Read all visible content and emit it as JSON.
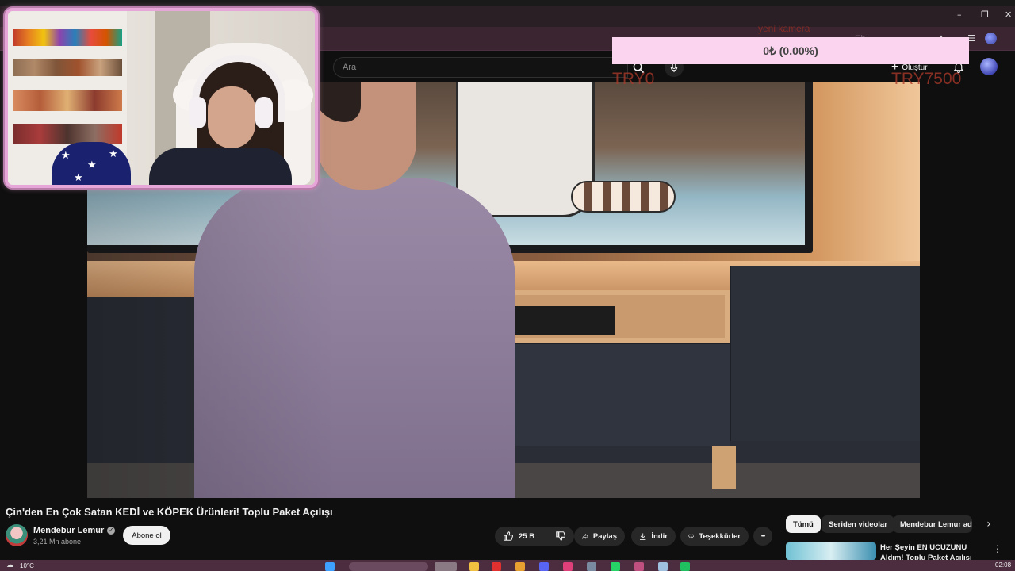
{
  "browser": {
    "window_controls": {
      "minimize": "–",
      "maximize": "❐",
      "close": "✕"
    },
    "ghost_toolbar_text": "Eh..."
  },
  "youtube": {
    "search": {
      "placeholder": "Ara"
    },
    "create_label": "Oluştur"
  },
  "donation_goal": {
    "title": "yeni kamera",
    "current": "0₺ (0.00%)",
    "min_label": "TRY0",
    "max_label": "TRY7500",
    "bar_color": "#fbd4ef",
    "progress_fraction": 0.0
  },
  "video": {
    "title": "Çin'den En Çok Satan KEDİ ve KÖPEK Ürünleri! Toplu Paket Açılışı",
    "channel": {
      "name": "Mendebur Lemur",
      "subscribers": "3,21 Mn abone",
      "verified": true
    },
    "subscribe_label": "Abone ol",
    "actions": {
      "likes": "25 B",
      "share": "Paylaş",
      "download": "İndir",
      "thanks": "Teşekkürler",
      "more": "•••"
    }
  },
  "sidebar": {
    "chips": [
      "Tümü",
      "Seriden videolar",
      "Mendebur Lemur adlı"
    ],
    "active_chip": "Tümü",
    "recommendation": {
      "title": "Her Şeyin EN UCUZUNU Aldım! Toplu Paket Açılışı"
    }
  },
  "taskbar": {
    "weather": "10°C",
    "clock": "02:08"
  },
  "colors": {
    "accent_webcam_border": "#e7a6d8",
    "taskbar": "#4b2d3f",
    "donation_text": "#b03a2a"
  }
}
